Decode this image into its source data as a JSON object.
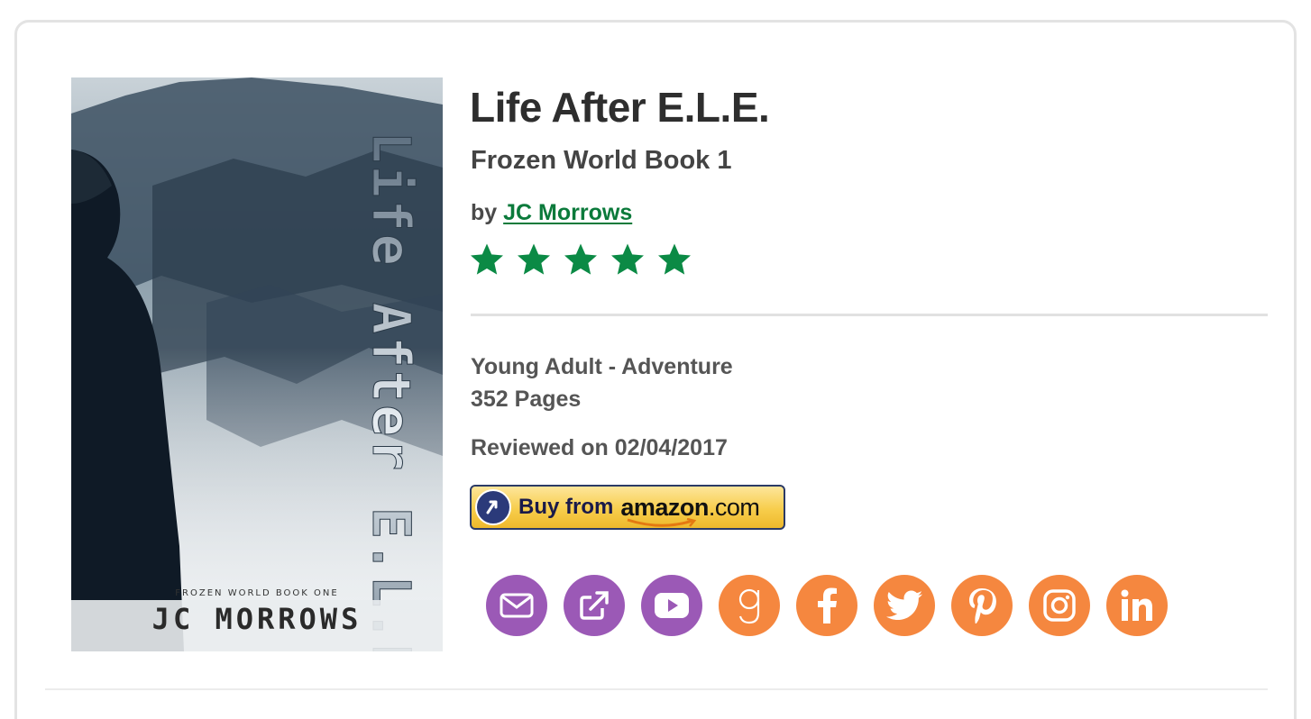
{
  "book": {
    "title": "Life After E.L.E.",
    "series": "Frozen World Book 1",
    "by_label": "by",
    "author": "JC Morrows",
    "rating_stars": 5,
    "genre": "Young Adult - Adventure",
    "pages": "352 Pages",
    "reviewed": "Reviewed on 02/04/2017"
  },
  "cover": {
    "title_text": "Life After E.L.E.",
    "series_text": "FROZEN WORLD   BOOK ONE",
    "author_text": "JC MORROWS"
  },
  "amazon_button": {
    "buy_label": "Buy from",
    "brand": "amazon",
    "tld": ".com"
  },
  "social_icons": [
    {
      "name": "email-icon",
      "color": "#9b59b6"
    },
    {
      "name": "external-link-icon",
      "color": "#9b59b6"
    },
    {
      "name": "youtube-icon",
      "color": "#9b59b6"
    },
    {
      "name": "goodreads-icon",
      "color": "#f5873f"
    },
    {
      "name": "facebook-icon",
      "color": "#f5873f"
    },
    {
      "name": "twitter-icon",
      "color": "#f5873f"
    },
    {
      "name": "pinterest-icon",
      "color": "#f5873f"
    },
    {
      "name": "instagram-icon",
      "color": "#f5873f"
    },
    {
      "name": "linkedin-icon",
      "color": "#f5873f"
    }
  ],
  "colors": {
    "star": "#0b8a45",
    "author_link": "#0b7a3b",
    "purple": "#9b59b6",
    "orange": "#f5873f"
  }
}
